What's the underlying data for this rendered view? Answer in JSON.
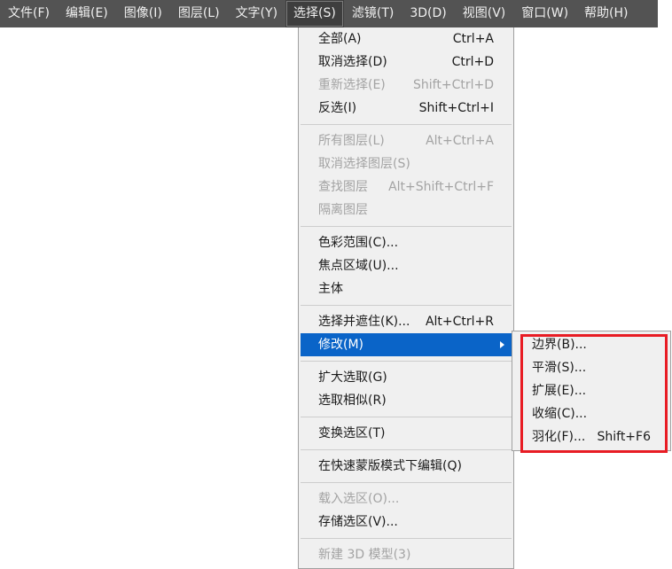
{
  "menubar": {
    "items": [
      {
        "label": "文件(F)"
      },
      {
        "label": "编辑(E)"
      },
      {
        "label": "图像(I)"
      },
      {
        "label": "图层(L)"
      },
      {
        "label": "文字(Y)"
      },
      {
        "label": "选择(S)"
      },
      {
        "label": "滤镜(T)"
      },
      {
        "label": "3D(D)"
      },
      {
        "label": "视图(V)"
      },
      {
        "label": "窗口(W)"
      },
      {
        "label": "帮助(H)"
      }
    ],
    "active_index": 5
  },
  "select_menu": {
    "groups": [
      [
        {
          "label": "全部(A)",
          "shortcut": "Ctrl+A",
          "disabled": false
        },
        {
          "label": "取消选择(D)",
          "shortcut": "Ctrl+D",
          "disabled": false
        },
        {
          "label": "重新选择(E)",
          "shortcut": "Shift+Ctrl+D",
          "disabled": true
        },
        {
          "label": "反选(I)",
          "shortcut": "Shift+Ctrl+I",
          "disabled": false
        }
      ],
      [
        {
          "label": "所有图层(L)",
          "shortcut": "Alt+Ctrl+A",
          "disabled": true
        },
        {
          "label": "取消选择图层(S)",
          "shortcut": "",
          "disabled": true
        },
        {
          "label": "查找图层",
          "shortcut": "Alt+Shift+Ctrl+F",
          "disabled": true
        },
        {
          "label": "隔离图层",
          "shortcut": "",
          "disabled": true
        }
      ],
      [
        {
          "label": "色彩范围(C)...",
          "shortcut": "",
          "disabled": false
        },
        {
          "label": "焦点区域(U)...",
          "shortcut": "",
          "disabled": false
        },
        {
          "label": "主体",
          "shortcut": "",
          "disabled": false
        }
      ],
      [
        {
          "label": "选择并遮住(K)...",
          "shortcut": "Alt+Ctrl+R",
          "disabled": false
        },
        {
          "label": "修改(M)",
          "shortcut": "",
          "disabled": false,
          "highlight": true,
          "submenu": true
        }
      ],
      [
        {
          "label": "扩大选取(G)",
          "shortcut": "",
          "disabled": false
        },
        {
          "label": "选取相似(R)",
          "shortcut": "",
          "disabled": false
        }
      ],
      [
        {
          "label": "变换选区(T)",
          "shortcut": "",
          "disabled": false
        }
      ],
      [
        {
          "label": "在快速蒙版模式下编辑(Q)",
          "shortcut": "",
          "disabled": false
        }
      ],
      [
        {
          "label": "载入选区(O)...",
          "shortcut": "",
          "disabled": true
        },
        {
          "label": "存储选区(V)...",
          "shortcut": "",
          "disabled": false
        }
      ],
      [
        {
          "label": "新建 3D 模型(3)",
          "shortcut": "",
          "disabled": true
        }
      ]
    ]
  },
  "modify_submenu": {
    "items": [
      {
        "label": "边界(B)...",
        "shortcut": ""
      },
      {
        "label": "平滑(S)...",
        "shortcut": ""
      },
      {
        "label": "扩展(E)...",
        "shortcut": ""
      },
      {
        "label": "收缩(C)...",
        "shortcut": ""
      },
      {
        "label": "羽化(F)...",
        "shortcut": "Shift+F6"
      }
    ]
  },
  "colors": {
    "menubar_bg": "#535353",
    "highlight": "#0a64c8",
    "annotation_box": "#e81c24"
  }
}
